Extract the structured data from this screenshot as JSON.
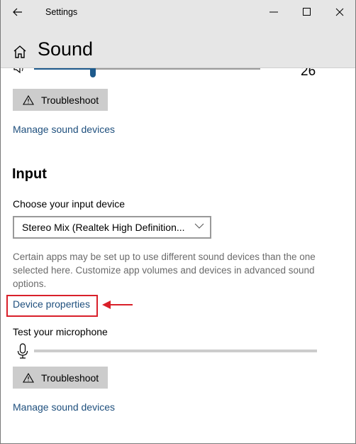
{
  "window": {
    "title": "Settings",
    "controls": {
      "back": "back-arrow-icon",
      "minimize": "minimize-icon",
      "maximize": "maximize-icon",
      "close": "close-icon"
    }
  },
  "header": {
    "title": "Sound",
    "icon": "home-icon"
  },
  "output": {
    "volume_value": "26",
    "volume_fraction": 0.26,
    "troubleshoot_label": "Troubleshoot",
    "manage_link": "Manage sound devices"
  },
  "input": {
    "section_title": "Input",
    "choose_label": "Choose your input device",
    "selected_device": "Stereo Mix (Realtek High Definition...",
    "description": "Certain apps may be set up to use different sound devices than the one selected here. Customize app volumes and devices in advanced sound options.",
    "device_properties_link": "Device properties",
    "test_mic_label": "Test your microphone",
    "mic_level_fraction": 0,
    "troubleshoot_label": "Troubleshoot",
    "manage_link": "Manage sound devices"
  },
  "annotation": {
    "highlight_color": "#d9202a",
    "target": "Device properties"
  },
  "colors": {
    "accent": "#1e5a8c",
    "link": "#1e4f7d",
    "button_bg": "#cccccc",
    "header_bg": "#e6e6e6"
  }
}
